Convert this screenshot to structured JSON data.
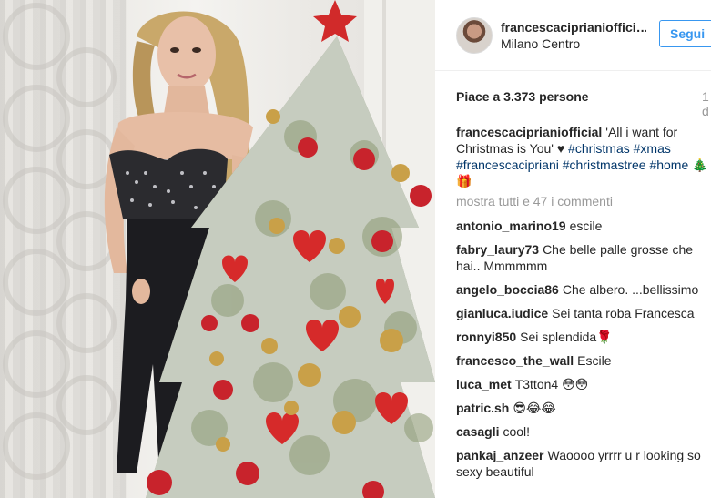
{
  "post": {
    "username": "francescaciprianiofficial",
    "username_display": "francescaciprianioffici…",
    "location": "Milano Centro",
    "follow_label": "Segui",
    "likes": "Piace a 3.373 persone",
    "time_fragment": "1 d",
    "caption": {
      "user": "francescaciprianiofficial",
      "text": "'All i want for Christmas is You' ♥",
      "hashtags": [
        "#christmas",
        "#xmas",
        "#francescacipriani",
        "#christmastree",
        "#home"
      ],
      "emoji": "🎄🎁"
    },
    "view_all": "mostra tutti e 47 i commenti",
    "comments": [
      {
        "user": "antonio_marino19",
        "text": "escile"
      },
      {
        "user": "fabry_laury73",
        "text": "Che belle palle grosse che hai.. Mmmmmm"
      },
      {
        "user": "angelo_boccia86",
        "text": "Che albero. ...bellissimo"
      },
      {
        "user": "gianluca.iudice",
        "text": "Sei tanta roba Francesca"
      },
      {
        "user": "ronnyi850",
        "text": "Sei splendida🌹"
      },
      {
        "user": "francesco_the_wall",
        "text": "Escile"
      },
      {
        "user": "luca_met",
        "text": "T3tton4 😳😳"
      },
      {
        "user": "patric.sh",
        "text": "😎😂😂"
      },
      {
        "user": "casagli",
        "text": "cool!"
      },
      {
        "user": "pankaj_anzeer",
        "text": "Waoooo yrrrr u r looking so sexy beautiful"
      }
    ]
  },
  "colors": {
    "link_blue": "#3897f0",
    "hashtag_blue": "#003569",
    "muted_gray": "#999999",
    "text": "#262626"
  }
}
